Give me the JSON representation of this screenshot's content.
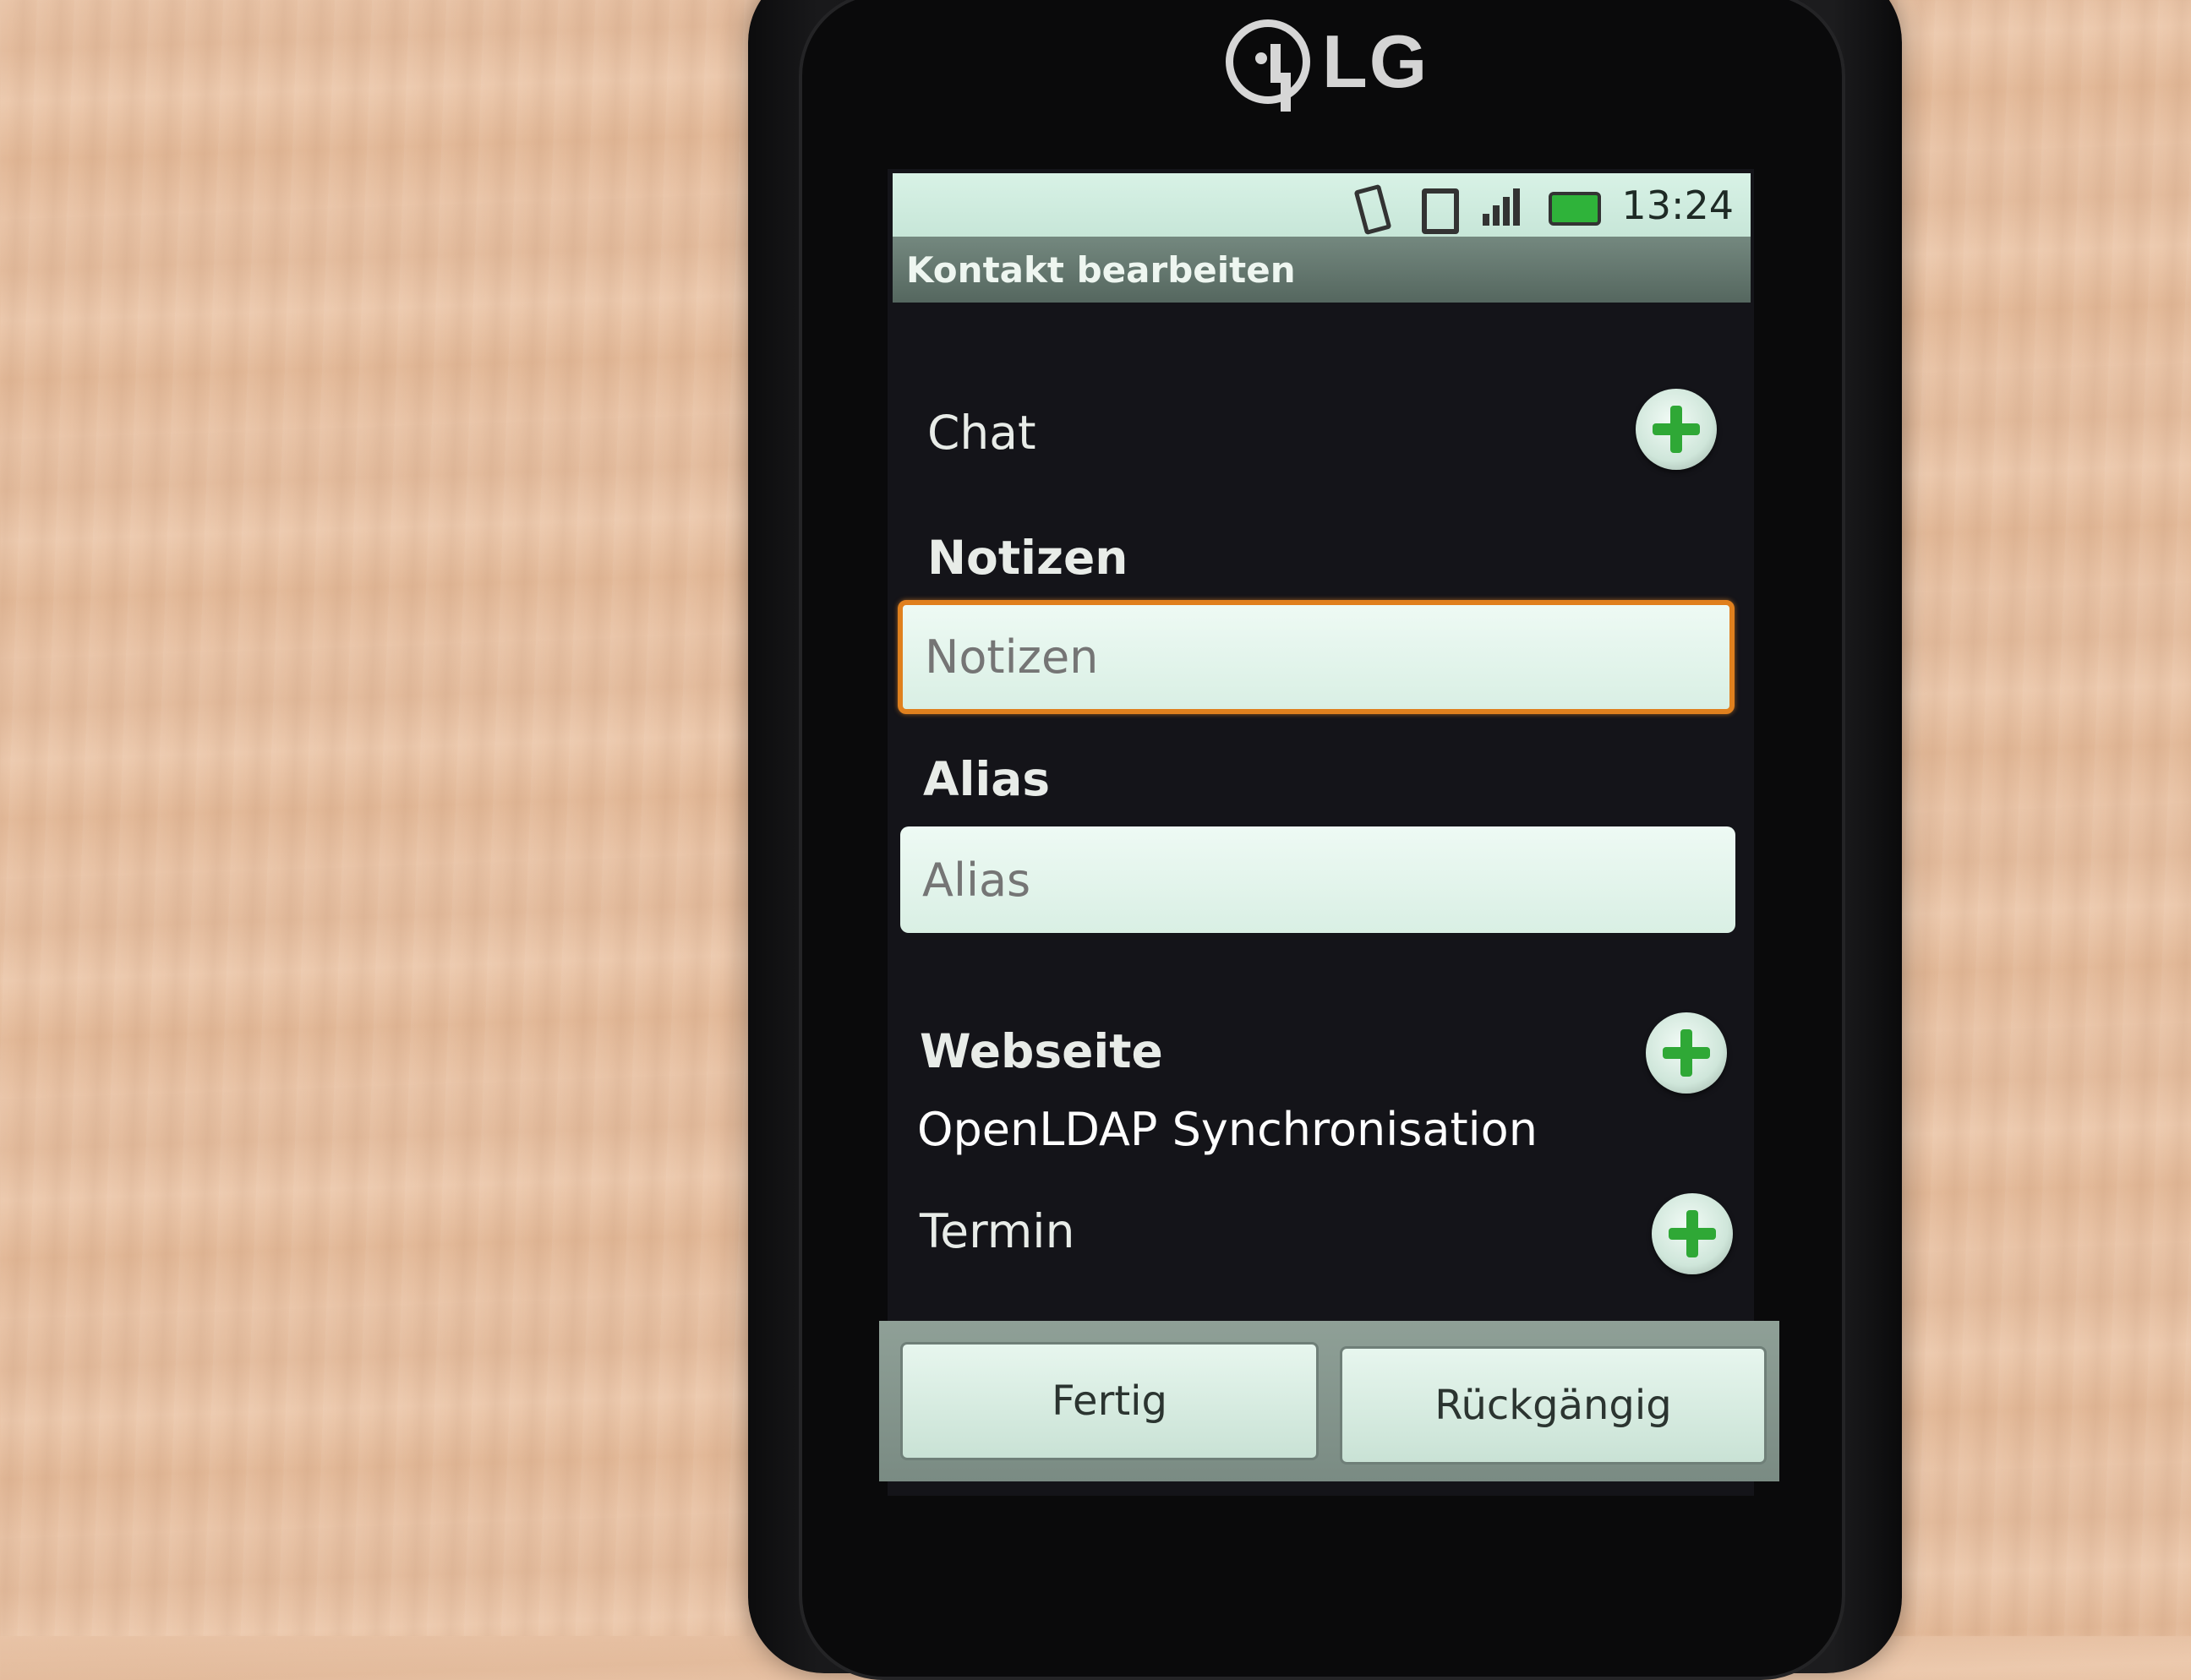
{
  "device": {
    "brand": "LG"
  },
  "status_bar": {
    "time": "13:24",
    "icons": [
      "vibrate-icon",
      "sim-card-icon",
      "signal-icon",
      "battery-icon"
    ],
    "battery_color": "#2fb33a"
  },
  "title_bar": {
    "title": "Kontakt bearbeiten"
  },
  "sections": {
    "chat": {
      "label": "Chat"
    },
    "notes": {
      "label": "Notizen",
      "placeholder": "Notizen",
      "value": ""
    },
    "alias": {
      "label": "Alias",
      "placeholder": "Alias",
      "value": ""
    },
    "website": {
      "label": "Webseite"
    },
    "appointment": {
      "label": "Termin"
    }
  },
  "caption": "OpenLDAP Synchronisation",
  "actions": {
    "done": "Fertig",
    "revert": "Rückgängig"
  },
  "colors": {
    "focus_border": "#e0801e",
    "add_icon": "#2fa836"
  }
}
